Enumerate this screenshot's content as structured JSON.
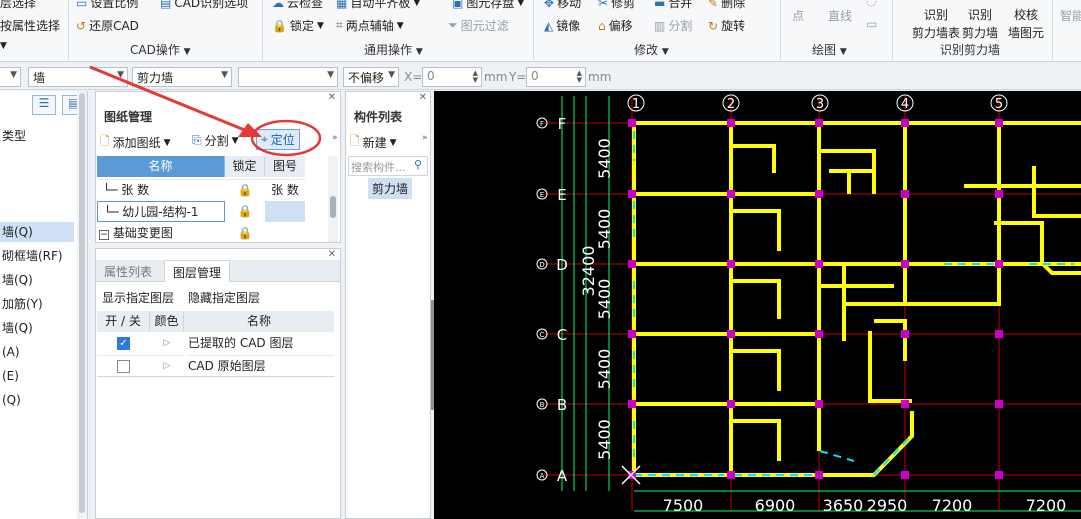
{
  "ribbon": {
    "row1": {
      "select_by_layer": "层选择",
      "set_scale": "设置比例",
      "cad_options": "CAD识别选项",
      "cloud_check": "云检查",
      "auto_flat_slab": "自动平齐板",
      "element_save": "图元存盘",
      "move": "移动",
      "trim": "修剪",
      "merge": "合并",
      "delete": "删除",
      "smart": "智能"
    },
    "row2": {
      "select_by_attr": "按属性选择",
      "restore_cad": "还原CAD",
      "lock": "锁定",
      "two_point_axis": "两点辅轴",
      "element_filter": "图元过滤",
      "mirror": "镜像",
      "offset": "偏移",
      "split": "分割",
      "rotate": "旋转",
      "point": "点",
      "line": "直线"
    },
    "recognize": {
      "identify_wall_table_1": "识别",
      "identify_wall_table_2": "剪力墙表",
      "identify_wall_1": "识别",
      "identify_wall_2": "剪力墙",
      "verify_1": "校核",
      "verify_2": "墙图元"
    },
    "groups": {
      "cad_ops": "CAD操作",
      "general_ops": "通用操作",
      "modify": "修改",
      "draw": "绘图",
      "identify_shear_wall": "识别剪力墙"
    }
  },
  "propbar": {
    "category": "墙",
    "type": "剪力墙",
    "blank": "",
    "offset_mode": "不偏移",
    "x_label": "X=",
    "x_value": "0",
    "x_unit": "mm",
    "y_label": "Y=",
    "y_value": "0",
    "y_unit": "mm"
  },
  "left_tree": {
    "type_label": "类型",
    "items": [
      "墙(Q)",
      "砌框墙(RF)",
      "墙(Q)",
      "加筋(Y)",
      "墙(Q)",
      "(A)",
      "(E)",
      "(Q)"
    ]
  },
  "drawing_mgmt": {
    "title": "图纸管理",
    "add_drawing": "添加图纸",
    "split": "分割",
    "locate": "定位",
    "col_name": "名称",
    "col_lock": "锁定",
    "col_number": "图号",
    "rows": [
      {
        "name": "张 数",
        "number": "张 数"
      },
      {
        "name": "幼儿园-结构-1",
        "number": ""
      },
      {
        "name": "基础变更图",
        "number": ""
      }
    ]
  },
  "layer_mgmt": {
    "tab_props": "属性列表",
    "tab_layers": "图层管理",
    "show_layer": "显示指定图层",
    "hide_layer": "隐藏指定图层",
    "col_onoff": "开 / 关",
    "col_color": "颜色",
    "col_name": "名称",
    "rows": [
      {
        "checked": true,
        "name": "已提取的 CAD 图层"
      },
      {
        "checked": false,
        "name": "CAD 原始图层"
      }
    ]
  },
  "component_list": {
    "title": "构件列表",
    "new": "新建",
    "search_placeholder": "搜索构件...",
    "items": [
      "剪力墙"
    ]
  },
  "cad": {
    "axes_top": [
      "1",
      "2",
      "3",
      "4",
      "5"
    ],
    "axes_left": [
      "F",
      "E",
      "D",
      "C",
      "B",
      "A"
    ],
    "dims_bottom": [
      "7500",
      "6900",
      "3650",
      "2950",
      "7200",
      "7200"
    ],
    "dims_left": [
      "5400",
      "5400",
      "5400",
      "5400",
      "5400"
    ],
    "total_left": "32400",
    "colors": {
      "background": "#000000",
      "wall": "#ffff00",
      "axis": "#cc0000",
      "cyan": "#00e5ff",
      "green": "#00ff66",
      "magenta": "#cc00cc"
    }
  },
  "annotation": {
    "arrow_color": "#e53935"
  }
}
